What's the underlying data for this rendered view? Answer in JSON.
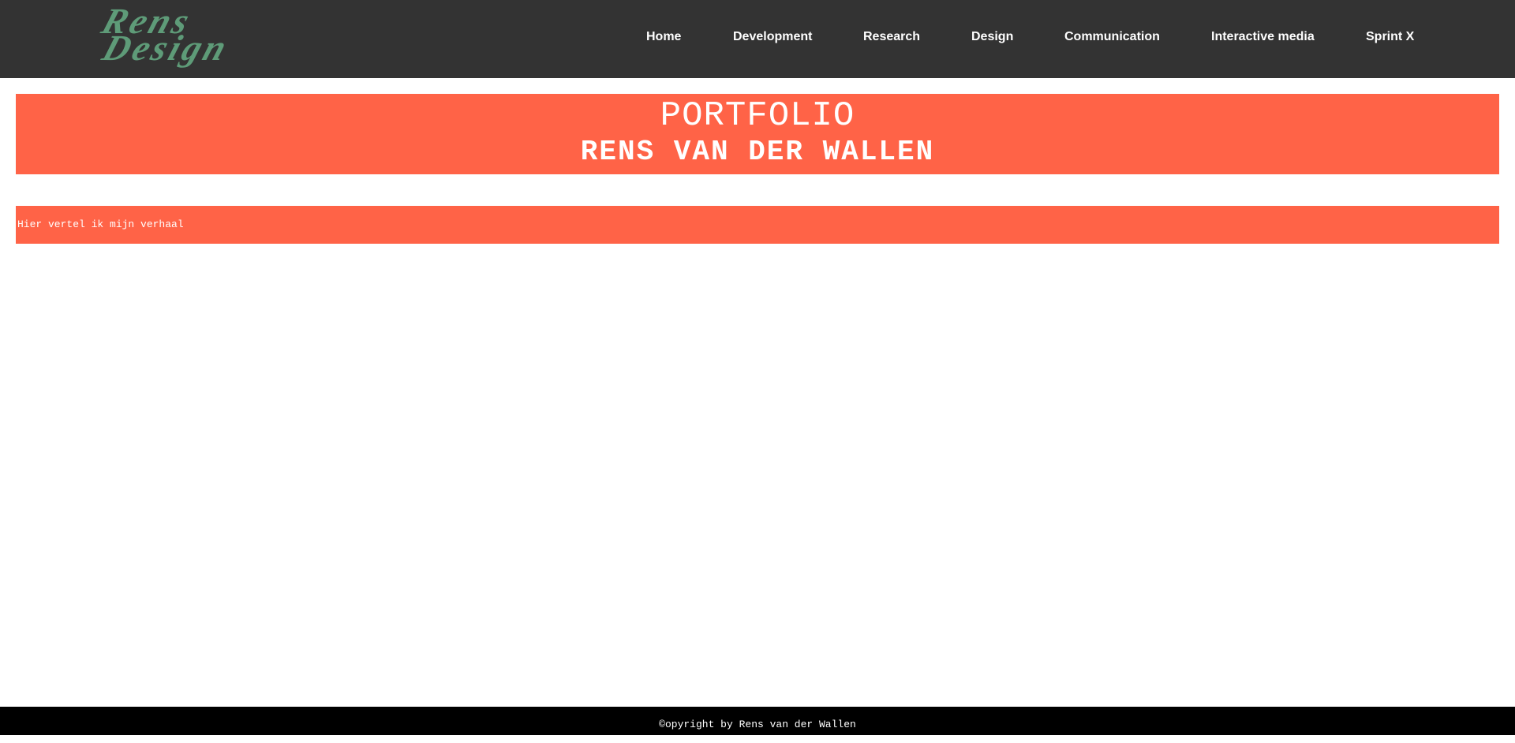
{
  "header": {
    "logo": {
      "line1": "Rens",
      "line2": "Design"
    },
    "nav": [
      {
        "label": "Home"
      },
      {
        "label": "Development"
      },
      {
        "label": "Research"
      },
      {
        "label": "Design"
      },
      {
        "label": "Communication"
      },
      {
        "label": "Interactive media"
      },
      {
        "label": "Sprint X"
      }
    ]
  },
  "banner": {
    "title": "PORTFOLIO",
    "subtitle": "RENS VAN DER WALLEN"
  },
  "story": {
    "text": "Hier vertel ik mijn verhaal"
  },
  "footer": {
    "copyright": "©opyright by Rens van der Wallen"
  },
  "colors": {
    "header_bg": "#333333",
    "accent": "#ff6347",
    "logo": "#5e9b78",
    "footer_bg": "#000000"
  }
}
